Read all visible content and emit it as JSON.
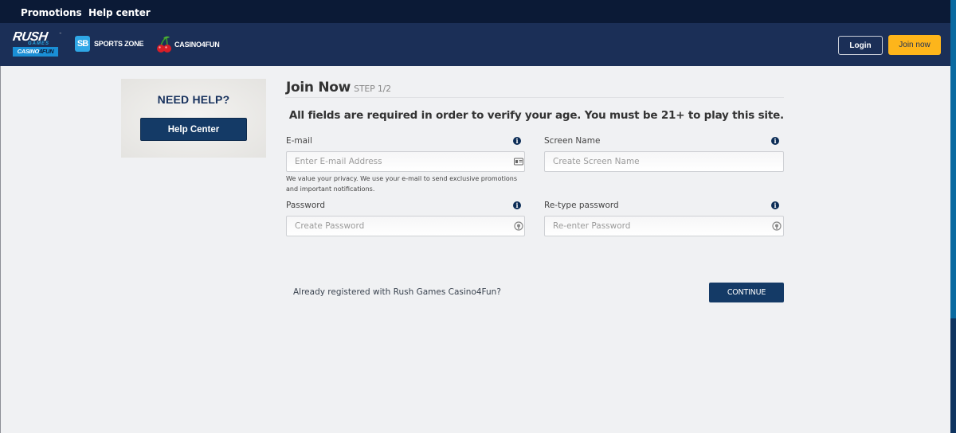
{
  "topbar": {
    "links": [
      {
        "label": "Promotions"
      },
      {
        "label": "Help center"
      }
    ]
  },
  "header": {
    "logo": {
      "line1": "RUSH",
      "trademark": "™",
      "line2": "GAMES",
      "line3_a": "CASINO",
      "line3_b": "4FUN"
    },
    "brands": [
      {
        "label": "SPORTS ZONE",
        "icon": "sb-icon",
        "icon_text": "SB"
      },
      {
        "label": "CASINO4FUN",
        "icon": "cherry-icon"
      }
    ],
    "login_label": "Login",
    "join_label": "Join now",
    "colors": {
      "accent": "#fdb51b",
      "header_bg": "#1b2f57",
      "topbar_bg": "#0b1a36",
      "primary_button": "#143a66"
    }
  },
  "help_card": {
    "title": "NEED HELP?",
    "button_label": "Help Center"
  },
  "form": {
    "title": "Join Now",
    "step": "STEP 1/2",
    "note": "All fields are required in order to verify your age. You must be 21+ to play this site.",
    "fields": {
      "email": {
        "label": "E-mail",
        "placeholder": "Enter E-mail Address",
        "value": "",
        "suffix_icon": "id-card-icon",
        "info_icon": "info-icon"
      },
      "screen_name": {
        "label": "Screen Name",
        "placeholder": "Create Screen Name",
        "value": "",
        "info_icon": "info-icon"
      },
      "password": {
        "label": "Password",
        "placeholder": "Create Password",
        "value": "",
        "suffix_icon": "eye-toggle-icon",
        "info_icon": "info-icon"
      },
      "retype_password": {
        "label": "Re-type password",
        "placeholder": "Re-enter Password",
        "value": "",
        "suffix_icon": "eye-toggle-icon",
        "info_icon": "info-icon"
      }
    },
    "email_help": "We value your privacy. We use your e-mail to send exclusive promotions and important notifications.",
    "already_registered": "Already registered with Rush Games Casino4Fun?",
    "continue_label": "CONTINUE",
    "info_glyph": "i"
  }
}
